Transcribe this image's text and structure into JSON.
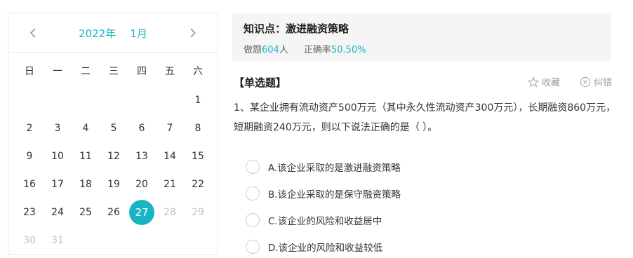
{
  "calendar": {
    "year_label": "2022年",
    "month_label": "1月",
    "weekdays": [
      "日",
      "一",
      "二",
      "三",
      "四",
      "五",
      "六"
    ],
    "weeks": [
      [
        {
          "d": ""
        },
        {
          "d": ""
        },
        {
          "d": ""
        },
        {
          "d": ""
        },
        {
          "d": ""
        },
        {
          "d": ""
        },
        {
          "d": "1"
        }
      ],
      [
        {
          "d": "2"
        },
        {
          "d": "3"
        },
        {
          "d": "4"
        },
        {
          "d": "5"
        },
        {
          "d": "6"
        },
        {
          "d": "7"
        },
        {
          "d": "8"
        }
      ],
      [
        {
          "d": "9"
        },
        {
          "d": "10"
        },
        {
          "d": "11"
        },
        {
          "d": "12"
        },
        {
          "d": "13"
        },
        {
          "d": "14"
        },
        {
          "d": "15"
        }
      ],
      [
        {
          "d": "16"
        },
        {
          "d": "17"
        },
        {
          "d": "18"
        },
        {
          "d": "19"
        },
        {
          "d": "20"
        },
        {
          "d": "21"
        },
        {
          "d": "22"
        }
      ],
      [
        {
          "d": "23"
        },
        {
          "d": "24"
        },
        {
          "d": "25"
        },
        {
          "d": "26"
        },
        {
          "d": "27",
          "selected": true
        },
        {
          "d": "28",
          "other": true
        },
        {
          "d": "29",
          "other": true
        }
      ],
      [
        {
          "d": "30",
          "other": true
        },
        {
          "d": "31",
          "other": true
        },
        {
          "d": ""
        },
        {
          "d": ""
        },
        {
          "d": ""
        },
        {
          "d": ""
        },
        {
          "d": ""
        }
      ]
    ]
  },
  "knowledge": {
    "title": "知识点：激进融资策略",
    "done_prefix": "做题",
    "done_count": "604",
    "done_suffix": "人",
    "accuracy_label": "正确率",
    "accuracy_value": "50.50%"
  },
  "question": {
    "type": "【单选题】",
    "favorite_label": "收藏",
    "report_label": "纠错",
    "text": "1、某企业拥有流动资产500万元（其中永久性流动资产300万元），长期融资860万元，短期融资240万元，则以下说法正确的是（   ）。",
    "options": [
      "A.该企业采取的是激进融资策略",
      "B.该企业采取的是保守融资策略",
      "C.该企业的风险和收益居中",
      "D.该企业的风险和收益较低"
    ]
  },
  "colors": {
    "accent": "#19b4c4",
    "panel_bg": "#f5f5f5"
  },
  "icons": {
    "prev": "chevron-left-icon",
    "next": "chevron-right-icon",
    "favorite": "star-icon",
    "report": "close-circle-icon"
  }
}
